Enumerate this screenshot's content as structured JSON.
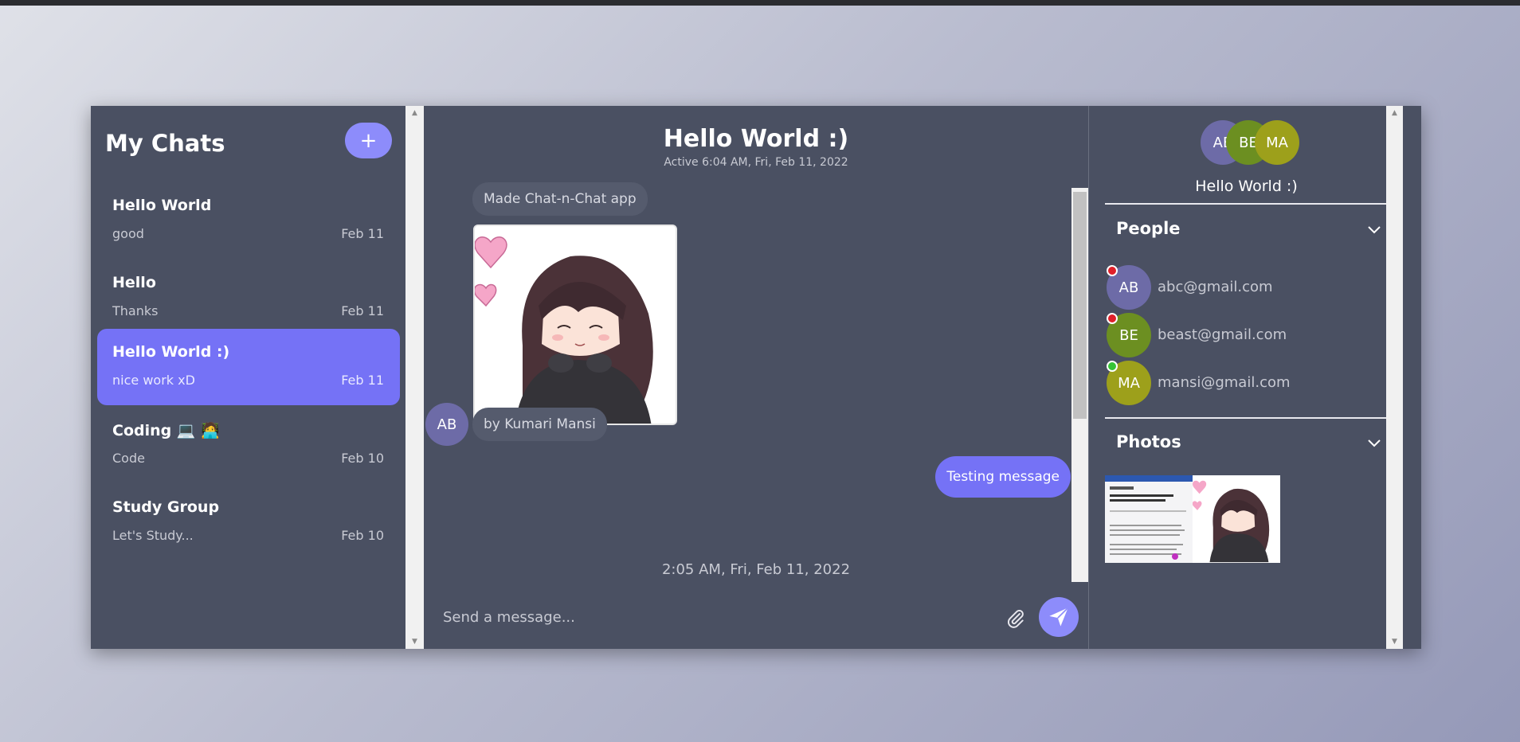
{
  "chat_list": {
    "title": "My Chats",
    "new_button": "+",
    "items": [
      {
        "name": "Hello World",
        "last": "good",
        "date": "Feb 11",
        "active": false
      },
      {
        "name": "Hello",
        "last": "Thanks",
        "date": "Feb 11",
        "active": false
      },
      {
        "name": "Hello World :)",
        "last": "nice work xD",
        "date": "Feb 11",
        "active": true
      },
      {
        "name": "Coding 💻 🧑‍💻",
        "last": "Code",
        "date": "Feb 10",
        "active": false
      },
      {
        "name": "Study Group",
        "last": "Let's Study...",
        "date": "Feb 10",
        "active": false
      }
    ]
  },
  "conversation": {
    "title": "Hello World :)",
    "status": "Active 6:04 AM, Fri, Feb 11, 2022",
    "messages": [
      {
        "text": "Made Chat-n-Chat app",
        "direction": "in"
      },
      {
        "type": "image",
        "direction": "in"
      },
      {
        "text": "by Kumari Mansi",
        "direction": "in",
        "avatar": "AB"
      },
      {
        "text": "Testing message",
        "direction": "out"
      }
    ],
    "timestamp": "2:05 AM, Fri, Feb 11, 2022",
    "composer_placeholder": "Send a message...",
    "attach_icon": "paperclip-icon",
    "send_icon": "send-icon"
  },
  "details": {
    "avatars": [
      "AB",
      "BE",
      "MA"
    ],
    "title": "Hello World :)",
    "people_label": "People",
    "people": [
      {
        "initials": "AB",
        "email": "abc@gmail.com",
        "online": false,
        "color": "#6d6ba7"
      },
      {
        "initials": "BE",
        "email": "beast@gmail.com",
        "online": false,
        "color": "#6c8f21"
      },
      {
        "initials": "MA",
        "email": "mansi@gmail.com",
        "online": true,
        "color": "#9da01b"
      }
    ],
    "photos_label": "Photos"
  },
  "colors": {
    "accent": "#7572f6",
    "button": "#8d8cfb",
    "panel": "#4a5062",
    "offline": "#e0202a",
    "online": "#36c436"
  }
}
